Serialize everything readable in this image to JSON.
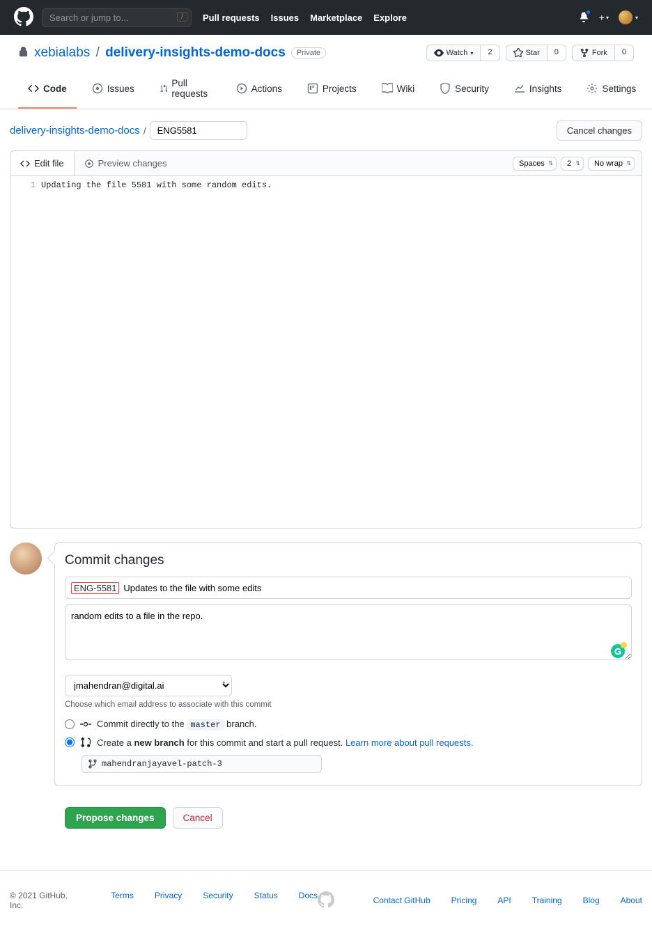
{
  "header": {
    "search_placeholder": "Search or jump to...",
    "nav": {
      "pulls": "Pull requests",
      "issues": "Issues",
      "marketplace": "Marketplace",
      "explore": "Explore"
    }
  },
  "repo": {
    "owner": "xebialabs",
    "name": "delivery-insights-demo-docs",
    "visibility": "Private",
    "watch": {
      "label": "Watch",
      "count": "2"
    },
    "star": {
      "label": "Star",
      "count": "0"
    },
    "fork": {
      "label": "Fork",
      "count": "0"
    }
  },
  "tabs": {
    "code": "Code",
    "issues": "Issues",
    "pulls": "Pull requests",
    "actions": "Actions",
    "projects": "Projects",
    "wiki": "Wiki",
    "security": "Security",
    "insights": "Insights",
    "settings": "Settings"
  },
  "breadcrumb": {
    "root": "delivery-insights-demo-docs",
    "filename": "ENG5581",
    "cancel": "Cancel changes"
  },
  "editor": {
    "tab_edit": "Edit file",
    "tab_preview": "Preview changes",
    "opt_indent": "Spaces",
    "opt_size": "2",
    "opt_wrap": "No wrap",
    "line1_num": "1",
    "line1": "Updating the file 5581 with some random edits."
  },
  "commit": {
    "title": "Commit changes",
    "ticket": "ENG-5581",
    "summary": "Updates to the file with some edits",
    "description": "random edits to a file in the repo.",
    "email": "jmahendran@digital.ai",
    "email_hint": "Choose which email address to associate with this commit",
    "direct_prefix": "Commit directly to the ",
    "direct_branch": "master",
    "direct_suffix": " branch.",
    "newbranch_prefix": "Create a ",
    "newbranch_bold": "new branch",
    "newbranch_mid": " for this commit and start a pull request. ",
    "newbranch_link": "Learn more about pull requests.",
    "branch_name": "mahendranjayavel-patch-3",
    "propose": "Propose changes",
    "cancel": "Cancel"
  },
  "footer": {
    "copyright": "© 2021 GitHub, Inc.",
    "terms": "Terms",
    "privacy": "Privacy",
    "security": "Security",
    "status": "Status",
    "docs": "Docs",
    "contact": "Contact GitHub",
    "pricing": "Pricing",
    "api": "API",
    "training": "Training",
    "blog": "Blog",
    "about": "About"
  }
}
